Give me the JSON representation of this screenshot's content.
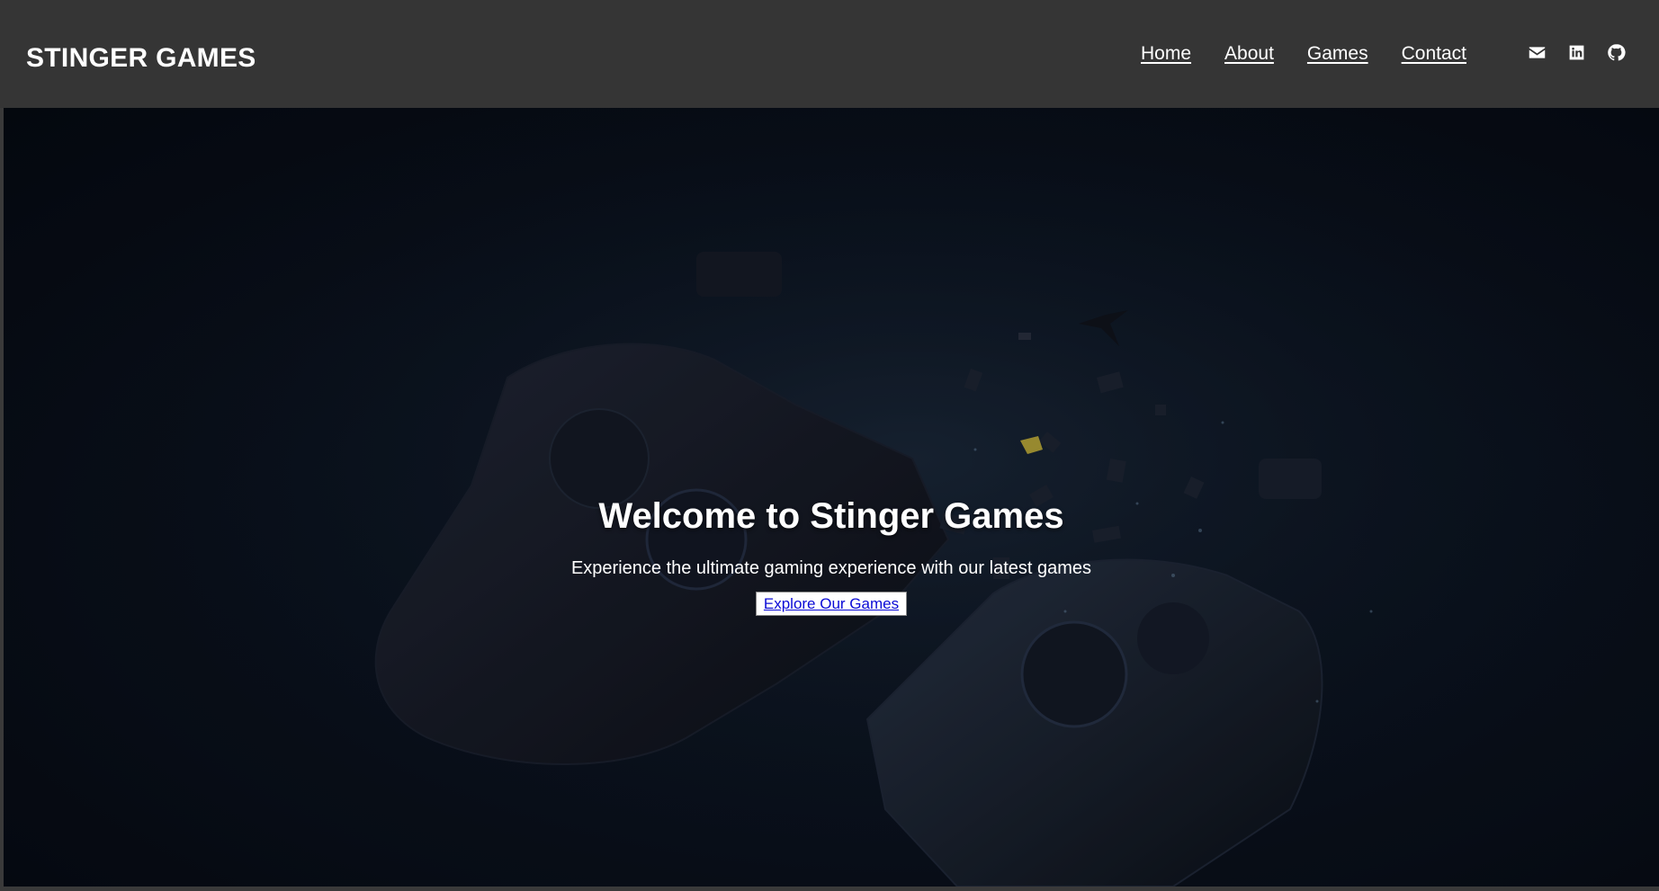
{
  "header": {
    "brand": "STINGER GAMES",
    "nav": [
      {
        "label": "Home"
      },
      {
        "label": "About"
      },
      {
        "label": "Games"
      },
      {
        "label": "Contact"
      }
    ],
    "social": [
      {
        "icon": "envelope-icon"
      },
      {
        "icon": "linkedin-icon"
      },
      {
        "icon": "github-icon"
      }
    ]
  },
  "hero": {
    "title": "Welcome to Stinger Games",
    "subtitle": "Experience the ultimate gaming experience with our latest games",
    "cta_label": "Explore Our Games",
    "background_image": "shattered-game-controller"
  },
  "colors": {
    "header_bg": "#353535",
    "hero_bg": "#0b1320",
    "text": "#ffffff",
    "cta_text": "#0b0bd6"
  }
}
